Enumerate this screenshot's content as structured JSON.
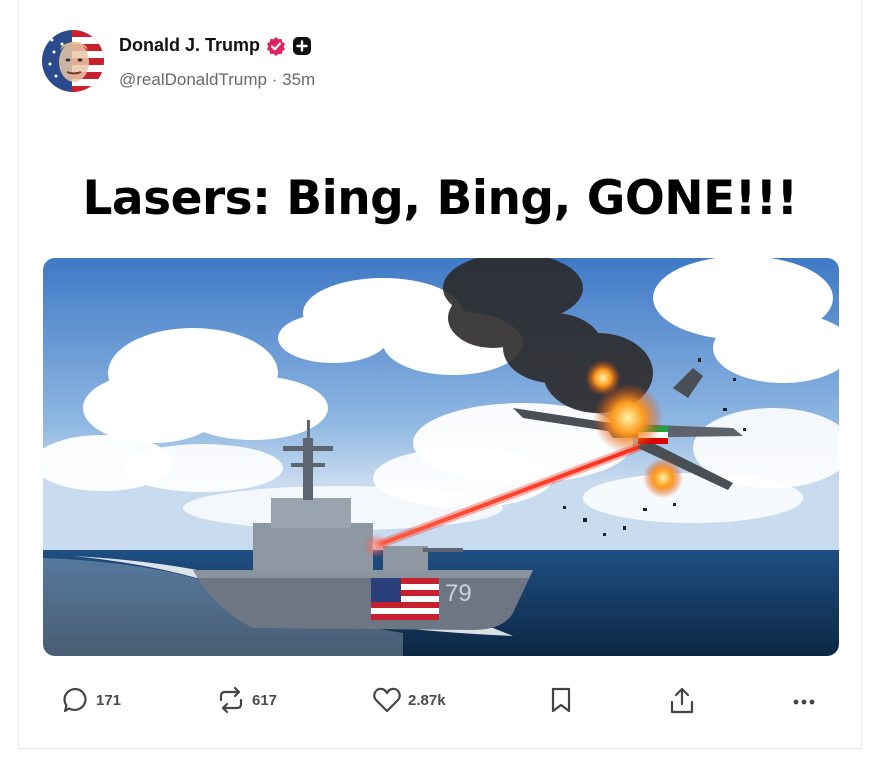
{
  "post": {
    "author": {
      "display_name": "Donald J. Trump",
      "handle": "@realDonaldTrump",
      "separator": "·",
      "time_ago": "35m",
      "verified_color": "#e0245e",
      "avatar_icon": "flag-portrait-avatar"
    },
    "headline": "Lasers: Bing, Bing, GONE!!!",
    "image": {
      "ship_hull_number": "79",
      "drone_flag_icon": "iran-flag",
      "laser_color": "#ff2a1a"
    },
    "actions": {
      "reply": {
        "icon": "reply-icon",
        "count": "171"
      },
      "repost": {
        "icon": "repost-icon",
        "count": "617"
      },
      "like": {
        "icon": "heart-icon",
        "count": "2.87k"
      },
      "bookmark": {
        "icon": "bookmark-icon"
      },
      "share": {
        "icon": "share-icon"
      },
      "more": {
        "icon": "more-icon"
      }
    }
  }
}
